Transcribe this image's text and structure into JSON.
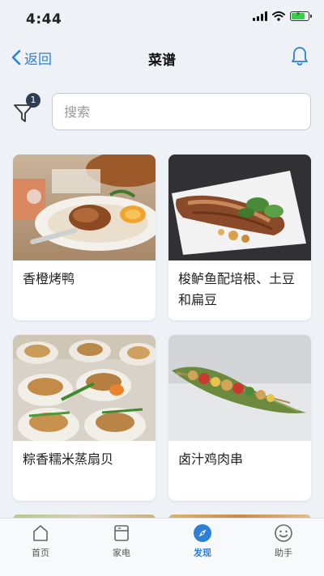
{
  "status_bar": {
    "time": "4:44"
  },
  "nav": {
    "back_label": "返回",
    "title": "菜谱"
  },
  "filter": {
    "badge_count": "1"
  },
  "search": {
    "placeholder": "搜索",
    "value": ""
  },
  "recipes": [
    {
      "title": "香橙烤鸭",
      "image": "roast-duck-orange-photo"
    },
    {
      "title": "梭鲈鱼配培根、土豆和扁豆",
      "image": "pike-perch-bacon-photo"
    },
    {
      "title": "粽香糯米蒸扇贝",
      "image": "steamed-scallops-photo"
    },
    {
      "title": "卤汁鸡肉串",
      "image": "chicken-skewer-photo"
    }
  ],
  "tab_bar": {
    "tabs": [
      {
        "label": "首页",
        "icon": "home-icon",
        "active": false
      },
      {
        "label": "家电",
        "icon": "appliance-icon",
        "active": false
      },
      {
        "label": "发现",
        "icon": "compass-icon",
        "active": true
      },
      {
        "label": "助手",
        "icon": "smiley-icon",
        "active": false
      }
    ]
  },
  "colors": {
    "accent": "#2c7fd6",
    "background": "#eef1f6",
    "badge": "#2e3d52"
  }
}
